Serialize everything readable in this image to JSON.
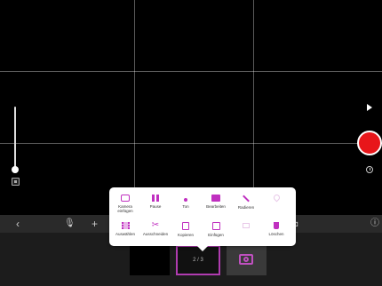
{
  "viewport": {
    "grid_rows": 3,
    "grid_cols": 3
  },
  "toolbar": {
    "back_icon": "chevron-left-icon",
    "mic_icon": "microphone-icon",
    "add_label": "+",
    "help_icon": "help-icon"
  },
  "filmstrip": {
    "selected_frame_label": "2 / 3"
  },
  "popup": {
    "row1": [
      {
        "icon": "camera-icon",
        "label": "Kamera einfügen",
        "enabled": true
      },
      {
        "icon": "pause-icon",
        "label": "Pause",
        "enabled": true
      },
      {
        "icon": "music-note-icon",
        "label": "Ton",
        "enabled": true
      },
      {
        "icon": "edit-icon",
        "label": "Bearbeiten",
        "enabled": true
      },
      {
        "icon": "wand-icon",
        "label": "Radieren",
        "enabled": true
      },
      {
        "icon": "heart-icon",
        "label": "",
        "enabled": false
      }
    ],
    "row2": [
      {
        "icon": "film-icon",
        "label": "Auswählen",
        "enabled": true
      },
      {
        "icon": "scissors-icon",
        "label": "Ausschneiden",
        "enabled": true
      },
      {
        "icon": "copy-icon",
        "label": "Kopieren",
        "enabled": true
      },
      {
        "icon": "clipboard-icon",
        "label": "Einfügen",
        "enabled": true
      },
      {
        "icon": "frame-icon",
        "label": "",
        "enabled": false
      },
      {
        "icon": "trash-icon",
        "label": "Löschen",
        "enabled": true
      }
    ]
  },
  "colors": {
    "accent": "#c030c0",
    "record": "#e8161a",
    "selected_frame_border": "#b03cb0"
  }
}
